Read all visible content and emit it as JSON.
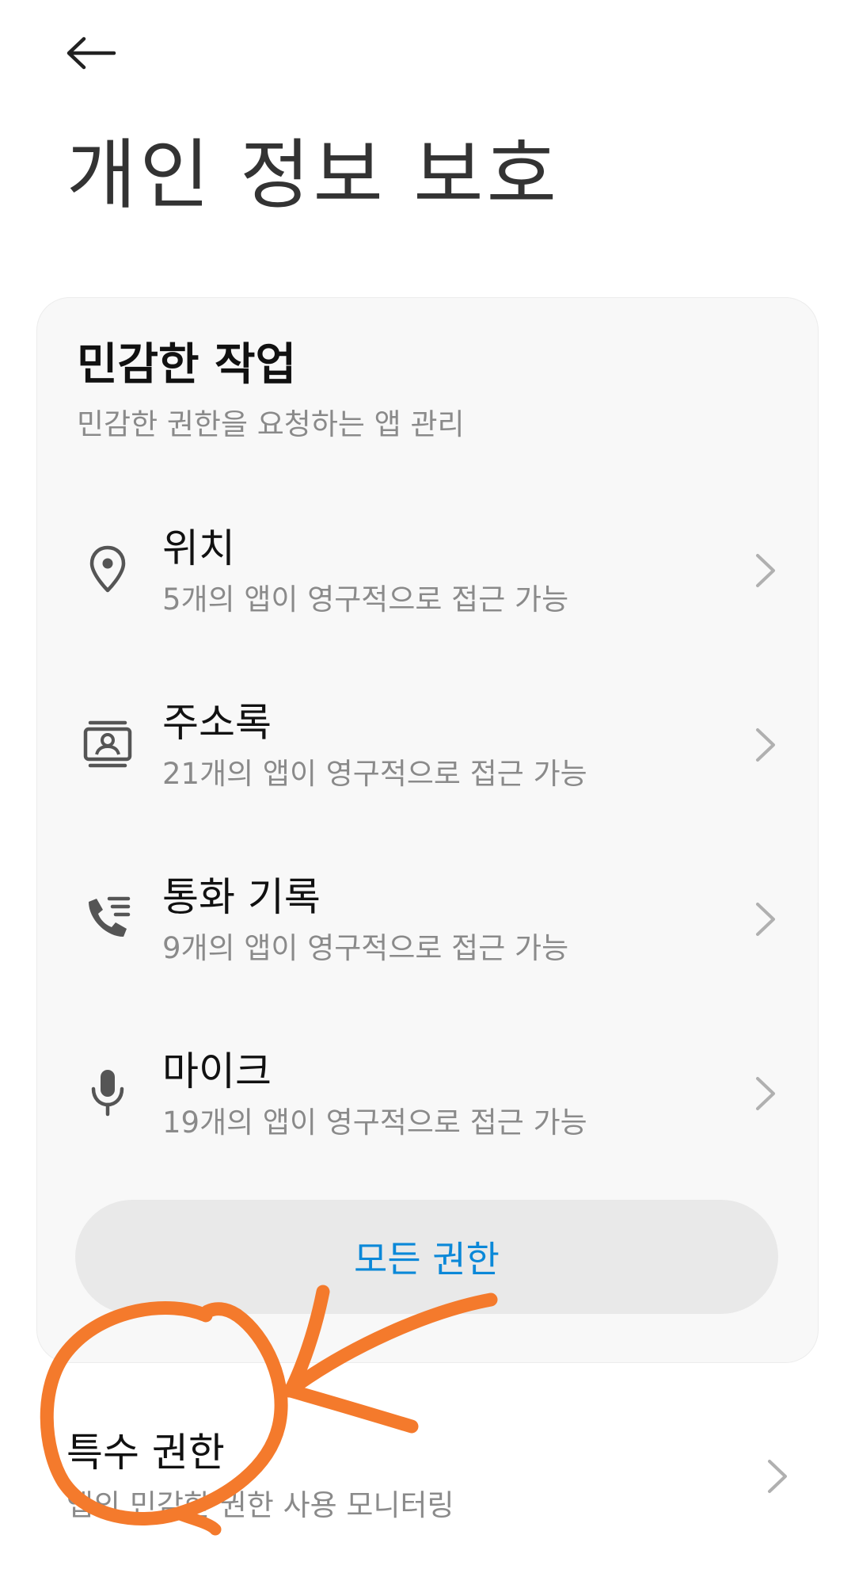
{
  "header": {
    "back_icon": "arrow-left-icon",
    "title": "개인 정보 보호"
  },
  "sensitive_actions": {
    "title": "민감한 작업",
    "subtitle": "민감한 권한을 요청하는 앱 관리",
    "items": [
      {
        "icon": "location-pin-icon",
        "label": "위치",
        "description": "5개의 앱이 영구적으로 접근 가능"
      },
      {
        "icon": "contacts-icon",
        "label": "주소록",
        "description": "21개의 앱이 영구적으로 접근 가능"
      },
      {
        "icon": "call-log-icon",
        "label": "통화 기록",
        "description": "9개의 앱이 영구적으로 접근 가능"
      },
      {
        "icon": "microphone-icon",
        "label": "마이크",
        "description": "19개의 앱이 영구적으로 접근 가능"
      }
    ],
    "all_permissions_label": "모든 권한"
  },
  "special_permissions": {
    "label": "특수 권한",
    "description": "앱의 민감한 권한 사용 모니터링"
  },
  "colors": {
    "accent": "#0b88d8",
    "annotation": "#f47a2c",
    "card_background": "#f8f8f8",
    "button_background": "#e9e9e9"
  }
}
